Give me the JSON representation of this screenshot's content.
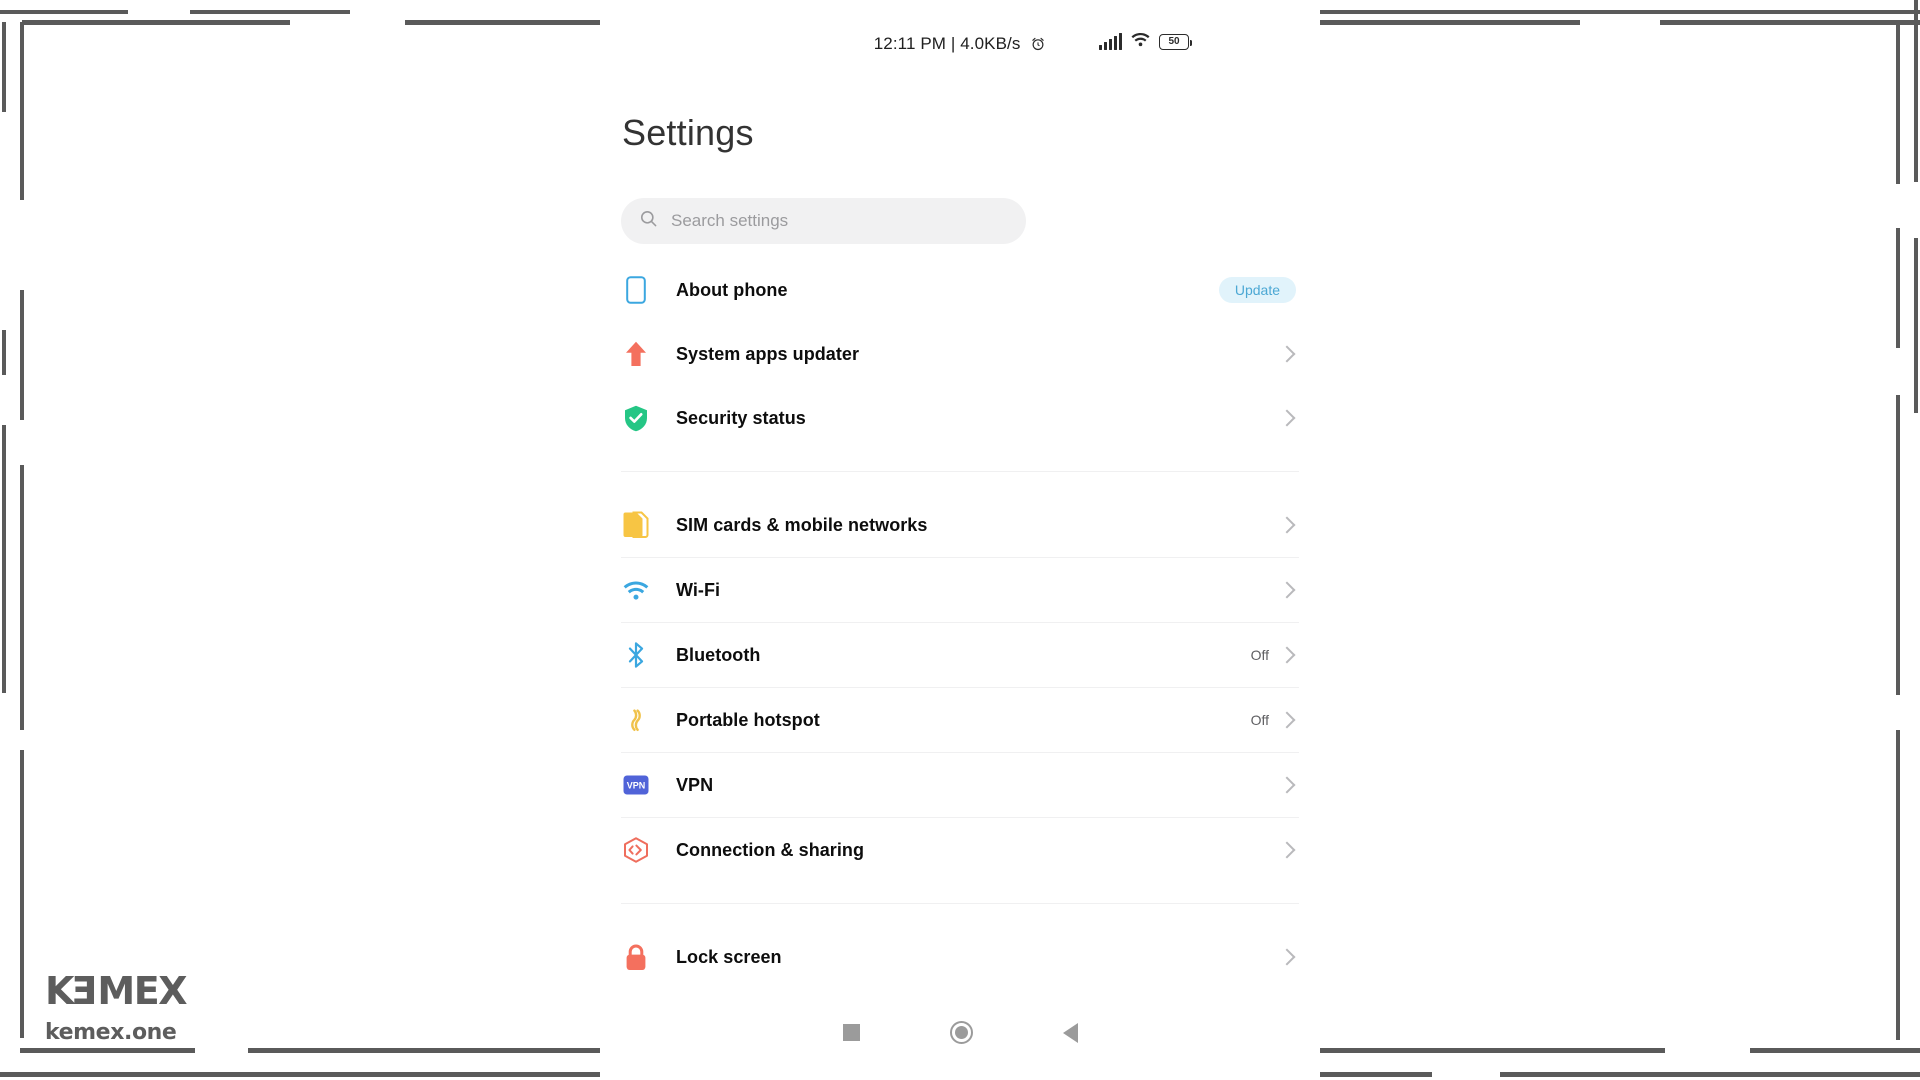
{
  "statusbar": {
    "time_and_speed": "12:11 PM | 4.0KB/s",
    "alarm_icon": "alarm-clock-icon",
    "signal_icon": "cellular-signal-icon",
    "wifi_icon": "wifi-icon",
    "battery_icon": "battery-icon",
    "battery_level": "50"
  },
  "header": {
    "title": "Settings"
  },
  "search": {
    "icon": "search-icon",
    "placeholder": "Search settings",
    "value": ""
  },
  "groups": [
    {
      "name": "device-group",
      "rows": [
        {
          "icon": "phone-outline-icon",
          "label": "About phone",
          "badge": "Update",
          "value": "",
          "chevron": false
        },
        {
          "icon": "up-arrow-icon",
          "label": "System apps updater",
          "badge": "",
          "value": "",
          "chevron": true
        },
        {
          "icon": "shield-check-icon",
          "label": "Security status",
          "badge": "",
          "value": "",
          "chevron": true
        }
      ]
    },
    {
      "name": "connectivity-group",
      "rows": [
        {
          "icon": "sim-card-icon",
          "label": "SIM cards & mobile networks",
          "badge": "",
          "value": "",
          "chevron": true
        },
        {
          "icon": "wifi-icon",
          "label": "Wi-Fi",
          "badge": "",
          "value": "",
          "chevron": true
        },
        {
          "icon": "bluetooth-icon",
          "label": "Bluetooth",
          "badge": "",
          "value": "Off",
          "chevron": true
        },
        {
          "icon": "hotspot-icon",
          "label": "Portable hotspot",
          "badge": "",
          "value": "Off",
          "chevron": true
        },
        {
          "icon": "vpn-icon",
          "label": "VPN",
          "badge": "",
          "value": "",
          "chevron": true
        },
        {
          "icon": "connection-sharing-icon",
          "label": "Connection & sharing",
          "badge": "",
          "value": "",
          "chevron": true
        }
      ]
    },
    {
      "name": "personal-group",
      "rows": [
        {
          "icon": "lock-icon",
          "label": "Lock screen",
          "badge": "",
          "value": "",
          "chevron": true
        }
      ]
    }
  ],
  "navbar": {
    "recents_label": "recents-button",
    "home_label": "home-button",
    "back_label": "back-button"
  },
  "watermark": {
    "brand_part1": "K",
    "brand_part2": "E",
    "brand_part3": "MEX",
    "domain": "kemex.one"
  },
  "colors": {
    "accent_blue": "#3ba7e0",
    "badge_bg": "#e1f3fb",
    "badge_text": "#4ca8d4",
    "icon_red": "#f4705e",
    "icon_green": "#25c685",
    "icon_yellow": "#f7c544",
    "icon_vpn": "#5063d8",
    "frame_gray": "#5a5a5a",
    "nav_gray": "#9b9b9b"
  }
}
